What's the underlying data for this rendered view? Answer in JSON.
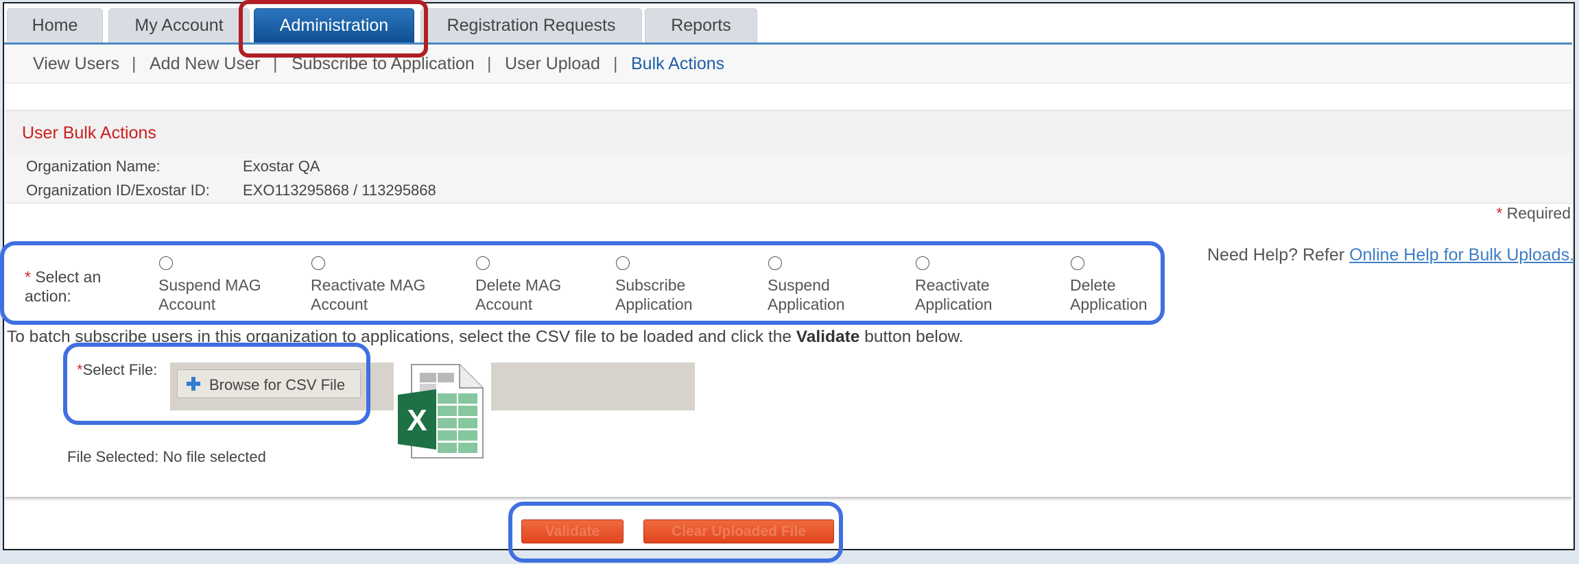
{
  "tabs": [
    {
      "label": "Home",
      "active": false
    },
    {
      "label": "My Account",
      "active": false
    },
    {
      "label": "Administration",
      "active": true
    },
    {
      "label": "Registration Requests",
      "active": false
    },
    {
      "label": "Reports",
      "active": false
    }
  ],
  "subnav": [
    {
      "label": "View Users"
    },
    {
      "label": "Add New User"
    },
    {
      "label": "Subscribe to Application"
    },
    {
      "label": "User Upload"
    },
    {
      "label": "Bulk Actions",
      "current": true
    }
  ],
  "panel": {
    "title": "User Bulk Actions",
    "org_name_label": "Organization Name:",
    "org_name_value": "Exostar QA",
    "org_id_label": "Organization ID/Exostar ID:",
    "org_id_value": "EXO113295868 / 113295868",
    "required_marker": "*",
    "required_note": "Required"
  },
  "help": {
    "text": "Need Help? Refer",
    "link": "Online Help for Bulk Uploads."
  },
  "action": {
    "label_line1": "Select an",
    "label_line2": "action:",
    "options": [
      {
        "line1": "Suspend MAG",
        "line2": "Account"
      },
      {
        "line1": "Reactivate MAG",
        "line2": "Account"
      },
      {
        "line1": "Delete MAG",
        "line2": "Account"
      },
      {
        "line1": "Subscribe",
        "line2": "Application"
      },
      {
        "line1": "Suspend",
        "line2": "Application"
      },
      {
        "line1": "Reactivate",
        "line2": "Application"
      },
      {
        "line1": "Delete",
        "line2": "Application"
      }
    ]
  },
  "instruction": {
    "before": "To batch subscribe users in this organization to applications, select the CSV file to be loaded and click the ",
    "bold": "Validate",
    "after": " button below."
  },
  "file": {
    "label": "Select File:",
    "browse_label": "Browse for CSV File",
    "selected_label": "File Selected:",
    "selected_value": "No file selected",
    "excel_letter": "X"
  },
  "buttons": {
    "validate": "Validate",
    "clear": "Clear Uploaded File"
  },
  "colors": {
    "tab_active": "#1a5fa8",
    "title_red": "#cc1f1f",
    "link_blue": "#3d7dc2",
    "button_orange": "#e8532a",
    "highlight_blue": "#3f6fe0",
    "highlight_red": "#b01e24"
  }
}
